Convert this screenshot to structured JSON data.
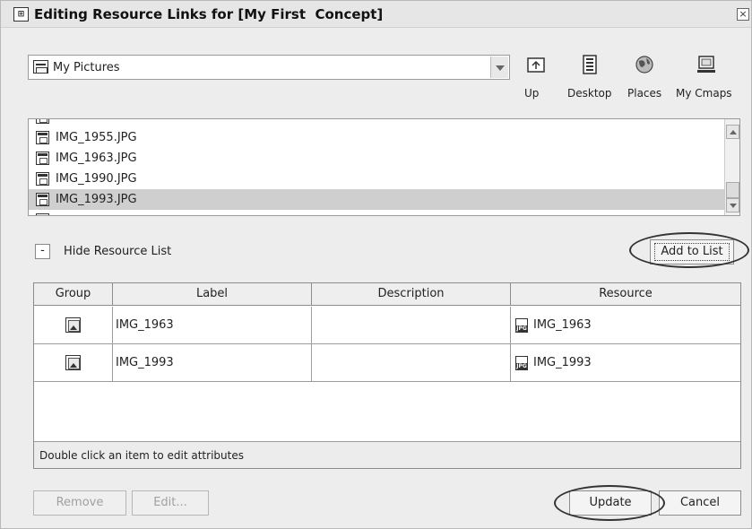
{
  "window": {
    "title": "Editing Resource Links for [My First  Concept]",
    "close_glyph": "×"
  },
  "location": {
    "current_folder": "My Pictures",
    "nav": [
      {
        "label": "Up",
        "icon": "up-folder-icon"
      },
      {
        "label": "Desktop",
        "icon": "desktop-icon"
      },
      {
        "label": "Places",
        "icon": "globe-icon"
      },
      {
        "label": "My Cmaps",
        "icon": "computer-icon"
      }
    ]
  },
  "file_list": {
    "items": [
      {
        "name": "IMG_1955.JPG",
        "selected": false
      },
      {
        "name": "IMG_1963.JPG",
        "selected": false
      },
      {
        "name": "IMG_1990.JPG",
        "selected": false
      },
      {
        "name": "IMG_1993.JPG",
        "selected": true
      }
    ]
  },
  "resource_panel": {
    "toggle_glyph": "-",
    "toggle_label": "Hide Resource List",
    "add_button": "Add to List"
  },
  "table": {
    "columns": [
      "Group",
      "Label",
      "Description",
      "Resource"
    ],
    "rows": [
      {
        "group_icon": "picture-icon",
        "label": "IMG_1963",
        "description": "",
        "resource": "IMG_1963",
        "resource_icon": "jpg-file-icon"
      },
      {
        "group_icon": "picture-icon",
        "label": "IMG_1993",
        "description": "",
        "resource": "IMG_1993",
        "resource_icon": "jpg-file-icon"
      }
    ],
    "status": "Double click an item to edit attributes"
  },
  "footer": {
    "remove": "Remove",
    "edit": "Edit...",
    "update": "Update",
    "cancel": "Cancel"
  },
  "jpg_icon_text": "JPG"
}
